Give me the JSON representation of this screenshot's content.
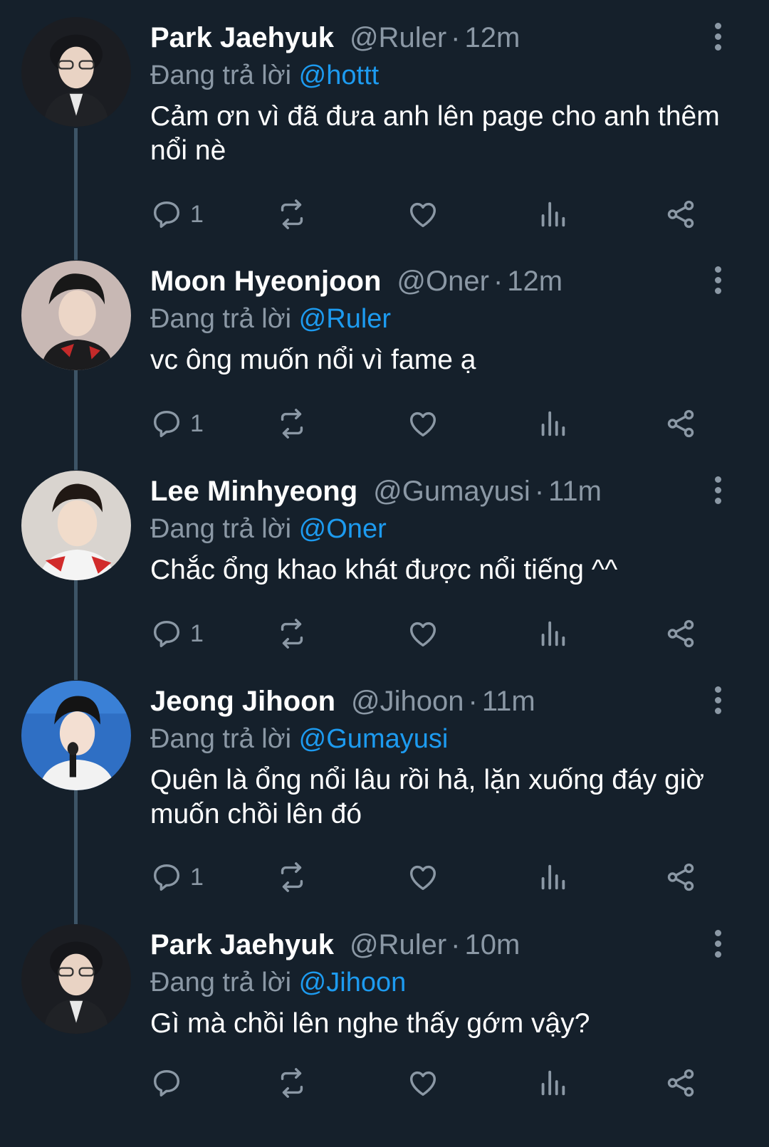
{
  "replying_prefix": "Đang trả lời",
  "colors": {
    "background": "#15202b",
    "muted": "#8b98a5",
    "mention": "#1d9bf0",
    "thread_line": "#3d5466"
  },
  "icons": [
    "reply-icon",
    "retweet-icon",
    "like-icon",
    "analytics-icon",
    "share-icon",
    "more-icon"
  ],
  "tweets": [
    {
      "name": "Park Jaehyuk",
      "handle": "@Ruler",
      "time": "12m",
      "reply_to": "@hottt",
      "text": "Cảm ơn vì đã đưa anh lên page cho anh thêm nổi nè",
      "reply_count": "1"
    },
    {
      "name": "Moon Hyeonjoon",
      "handle": "@Oner",
      "time": "12m",
      "reply_to": "@Ruler",
      "text": "vc ông muốn nổi vì fame ạ",
      "reply_count": "1"
    },
    {
      "name": "Lee Minhyeong",
      "handle": "@Gumayusi",
      "time": "11m",
      "reply_to": "@Oner",
      "text": "Chắc ổng khao khát được nổi tiếng ^^",
      "reply_count": "1"
    },
    {
      "name": "Jeong Jihoon",
      "handle": "@Jihoon",
      "time": "11m",
      "reply_to": "@Gumayusi",
      "text": "Quên là ổng nổi lâu rồi hả, lặn xuống đáy giờ muốn chồi lên đó",
      "reply_count": "1"
    },
    {
      "name": "Park Jaehyuk",
      "handle": "@Ruler",
      "time": "10m",
      "reply_to": "@Jihoon",
      "text": "Gì mà chồi lên nghe thấy gớm vậy?",
      "reply_count": ""
    }
  ]
}
